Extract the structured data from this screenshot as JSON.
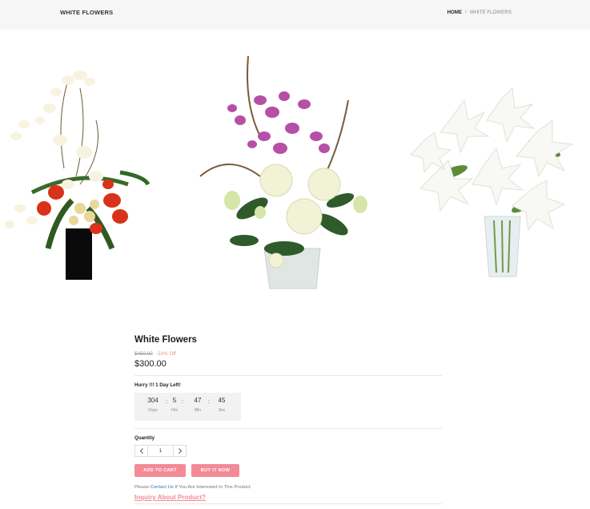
{
  "header": {
    "title": "WHITE FLOWERS",
    "breadcrumb": {
      "home": "HOME",
      "separator": "/",
      "current": "WHITE FLOWERS"
    }
  },
  "gallery": {
    "images": [
      {
        "name": "orchid-rose-arrangement"
      },
      {
        "name": "orchid-peony-vase"
      },
      {
        "name": "white-lily-vase"
      }
    ]
  },
  "product": {
    "name": "White Flowers",
    "old_price": "$450.00",
    "discount": "-33% Off",
    "price": "$300.00",
    "hurry": "Hurry !!! 1 Day Left!",
    "countdown": {
      "days": "304",
      "days_label": "Days",
      "hrs": "5",
      "hrs_label": "Hrs",
      "min": "47",
      "min_label": "Min",
      "sec": "45",
      "sec_label": "Sec",
      "colon": ":"
    },
    "quantity_label": "Quantity",
    "quantity_value": "1",
    "add_to_cart": "ADD TO CART",
    "buy_it_now": "BUY IT NOW",
    "contact_prefix": "Please",
    "contact_link": "Contact Us",
    "contact_suffix": "If You Are Interested In This Product.",
    "inquiry": "Inquiry About Product?"
  },
  "colors": {
    "accent": "#f38a95",
    "link": "#2f78c4",
    "discount": "#f0948c",
    "header_bg": "#f6f6f6"
  }
}
